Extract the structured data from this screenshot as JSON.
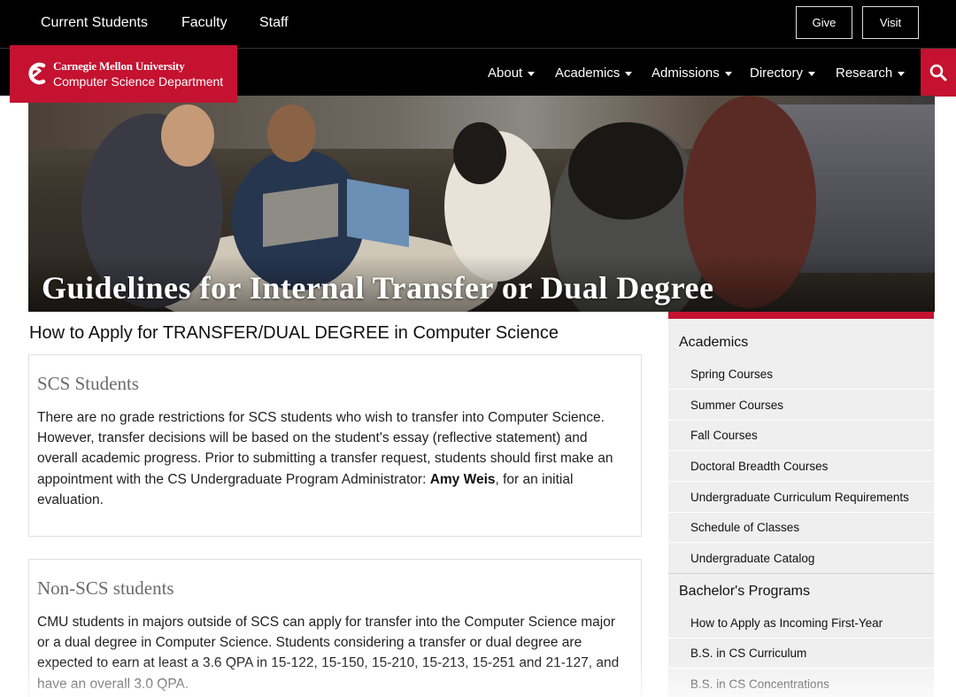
{
  "topbar": {
    "links": [
      "Current Students",
      "Faculty",
      "Staff"
    ],
    "give_label": "Give",
    "visit_label": "Visit"
  },
  "logo": {
    "university": "Carnegie Mellon University",
    "department": "Computer Science Department"
  },
  "nav": {
    "items": [
      "About",
      "Academics",
      "Admissions",
      "Directory",
      "Research"
    ],
    "search_icon": "search-icon"
  },
  "hero": {
    "title": "Guidelines for Internal Transfer or Dual Degree"
  },
  "main": {
    "heading": "How to Apply for TRANSFER/DUAL DEGREE in Computer Science",
    "sections": [
      {
        "title": "SCS Students",
        "text_before": "There are no grade restrictions for SCS students who wish to transfer into Computer Science. However, transfer decisions will be based on the student's essay (reflective statement) and overall academic progress. Prior to submitting a transfer request, students should first make an appointment with the CS Undergraduate Program Administrator: ",
        "bold": "Amy Weis",
        "text_after": ", for an initial evaluation."
      },
      {
        "title": "Non-SCS students",
        "text": "CMU students in majors outside of SCS can apply for transfer into the Computer Science major or a dual degree in Computer Science. Students considering a transfer or dual degree are expected to earn at least a 3.6 QPA in 15-122, 15-150, 15-210, 15-213, 15-251 and 21-127, and have an overall 3.0 QPA."
      }
    ]
  },
  "sidebar": {
    "academics_heading": "Academics",
    "academics_items": [
      "Spring Courses",
      "Summer Courses",
      "Fall Courses",
      "Doctoral Breadth Courses",
      "Undergraduate Curriculum Requirements",
      "Schedule of Classes",
      "Undergraduate Catalog"
    ],
    "bachelors_heading": "Bachelor's Programs",
    "bachelors_items": [
      "How to Apply as Incoming First-Year",
      "B.S. in CS Curriculum",
      "B.S. in CS Concentrations"
    ]
  },
  "colors": {
    "brand_red": "#c41230",
    "nav_black": "#000000",
    "sidebar_bg": "#efefef"
  }
}
